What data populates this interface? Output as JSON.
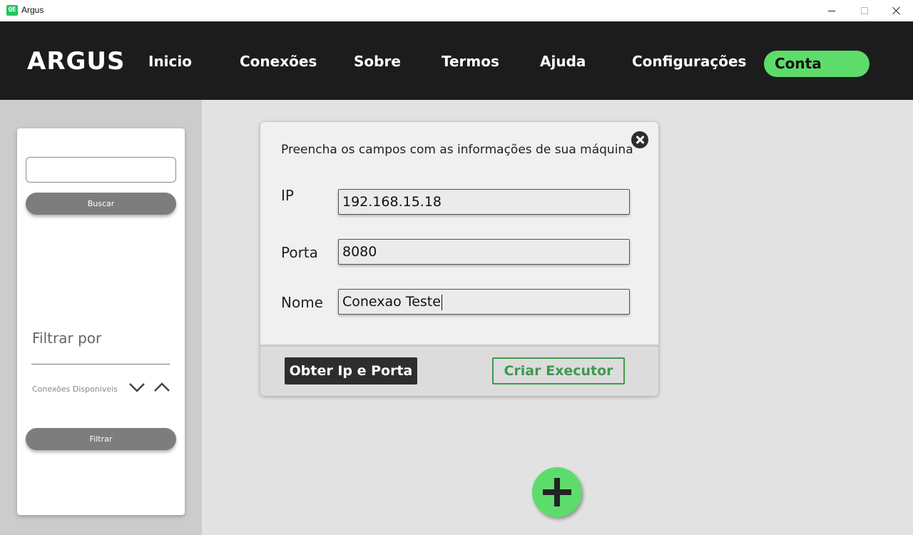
{
  "window": {
    "app_icon_text": "QE",
    "title": "Argus"
  },
  "navbar": {
    "brand": "ARGUS",
    "links": [
      "Inicio",
      "Conexões",
      "Sobre",
      "Termos",
      "Ajuda",
      "Configurações"
    ],
    "account_button": "Conta",
    "background": "#1c1c1c",
    "accent": "#5ddc6b"
  },
  "sidebar": {
    "search": {
      "value": "",
      "placeholder": ""
    },
    "search_button": "Buscar",
    "filter_title": "Filtrar por",
    "filter_option": "Conexões Disponiveis",
    "filter_button": "Filtrar"
  },
  "dialog": {
    "heading": "Preencha os campos com as informações de sua máquina",
    "fields": {
      "ip": {
        "label": "IP",
        "value": "192.168.15.18"
      },
      "porta": {
        "label": "Porta",
        "value": "8080"
      },
      "nome": {
        "label": "Nome",
        "value": "Conexao Teste"
      }
    },
    "get_ip_button": "Obter Ip e Porta",
    "create_button": "Criar Executor",
    "create_color": "#3e9a4d"
  },
  "fab": {
    "icon": "plus-icon"
  }
}
